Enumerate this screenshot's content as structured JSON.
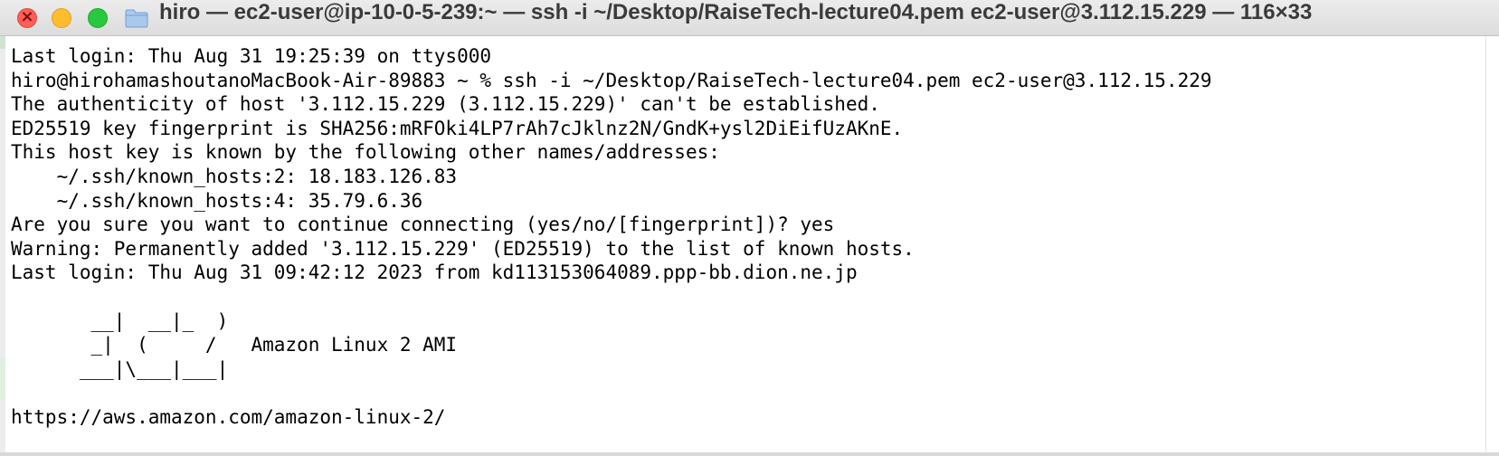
{
  "window": {
    "title": "hiro — ec2-user@ip-10-0-5-239:~ — ssh -i ~/Desktop/RaiseTech-lecture04.pem ec2-user@3.112.15.229 — 116×33"
  },
  "icons": {
    "close": "close-icon",
    "minimize": "minimize-icon",
    "zoom": "zoom-icon",
    "folder": "folder-icon"
  },
  "colors": {
    "close": "#ff5f57",
    "minimize": "#febc2e",
    "zoom": "#28c840",
    "folder": "#8fb8e6"
  },
  "terminal": {
    "lines": [
      "Last login: Thu Aug 31 19:25:39 on ttys000",
      "hiro@hirohamashoutanoMacBook-Air-89883 ~ % ssh -i ~/Desktop/RaiseTech-lecture04.pem ec2-user@3.112.15.229",
      "The authenticity of host '3.112.15.229 (3.112.15.229)' can't be established.",
      "ED25519 key fingerprint is SHA256:mRFOki4LP7rAh7cJklnz2N/GndK+ysl2DiEifUzAKnE.",
      "This host key is known by the following other names/addresses:",
      "    ~/.ssh/known_hosts:2: 18.183.126.83",
      "    ~/.ssh/known_hosts:4: 35.79.6.36",
      "Are you sure you want to continue connecting (yes/no/[fingerprint])? yes",
      "Warning: Permanently added '3.112.15.229' (ED25519) to the list of known hosts.",
      "Last login: Thu Aug 31 09:42:12 2023 from kd113153064089.ppp-bb.dion.ne.jp",
      "",
      "       __|  __|_  )",
      "       _|  (     /   Amazon Linux 2 AMI",
      "      ___|\\___|___|",
      "",
      "https://aws.amazon.com/amazon-linux-2/"
    ]
  }
}
